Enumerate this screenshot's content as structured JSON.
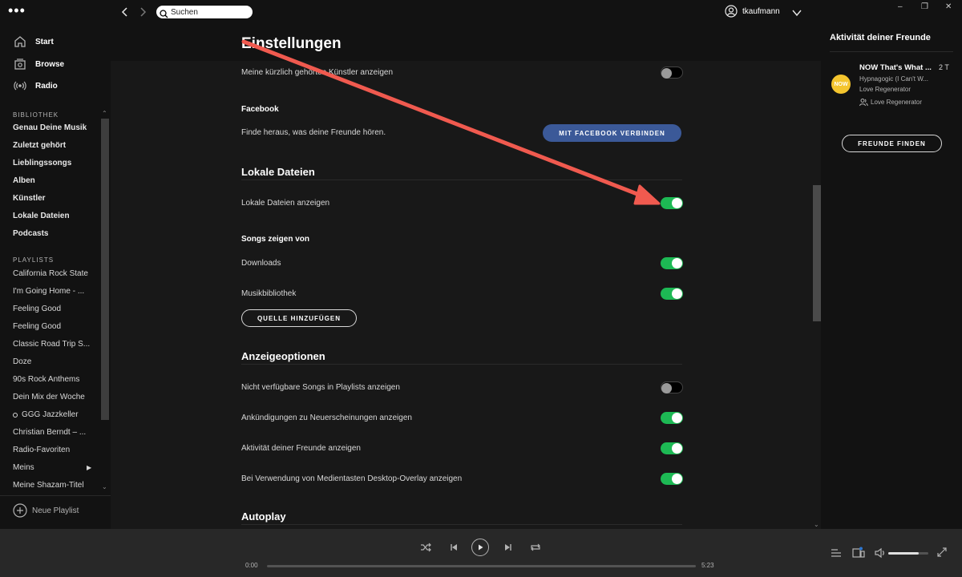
{
  "window": {
    "menu_dots": "•••"
  },
  "nav": {
    "items": [
      {
        "label": "Start",
        "icon": "home-icon"
      },
      {
        "label": "Browse",
        "icon": "browse-icon"
      },
      {
        "label": "Radio",
        "icon": "radio-icon"
      }
    ]
  },
  "library": {
    "heading": "BIBLIOTHEK",
    "items": [
      "Genau Deine Musik",
      "Zuletzt gehört",
      "Lieblingssongs",
      "Alben",
      "Künstler",
      "Lokale Dateien",
      "Podcasts"
    ]
  },
  "playlists": {
    "heading": "PLAYLISTS",
    "items": [
      "California Rock State",
      "I'm Going Home - ...",
      "Feeling Good",
      "Feeling Good",
      "Classic Road Trip S...",
      "Doze",
      "90s Rock Anthems",
      "Dein Mix der Woche",
      "GGG Jazzkeller",
      "Christian Berndt – ...",
      "Radio-Favoriten",
      "Meins",
      "Meine Shazam-Titel"
    ],
    "new_playlist": "Neue Playlist"
  },
  "topbar": {
    "search_placeholder": "Suchen",
    "username": "tkaufmann"
  },
  "settings": {
    "title": "Einstellungen",
    "recent_artists": {
      "label": "Meine kürzlich gehörten Künstler anzeigen",
      "on": false
    },
    "facebook": {
      "heading": "Facebook",
      "text": "Finde heraus, was deine Freunde hören.",
      "button": "MIT FACEBOOK VERBINDEN"
    },
    "local_files": {
      "heading": "Lokale Dateien",
      "show_label": "Lokale Dateien anzeigen",
      "show_on": true,
      "sources_heading": "Songs zeigen von",
      "sources": [
        {
          "label": "Downloads",
          "on": true
        },
        {
          "label": "Musikbibliothek",
          "on": true
        }
      ],
      "add_source": "QUELLE HINZUFÜGEN"
    },
    "display": {
      "heading": "Anzeigeoptionen",
      "options": [
        {
          "label": "Nicht verfügbare Songs in Playlists anzeigen",
          "on": false
        },
        {
          "label": "Ankündigungen zu Neuerscheinungen anzeigen",
          "on": true
        },
        {
          "label": "Aktivität deiner Freunde anzeigen",
          "on": true
        },
        {
          "label": "Bei Verwendung von Medientasten Desktop-Overlay anzeigen",
          "on": true
        }
      ]
    },
    "autoplay": {
      "heading": "Autoplay"
    }
  },
  "friends": {
    "title": "Aktivität deiner Freunde",
    "activity": {
      "avatar_text": "NOW",
      "song": "NOW That's What ...",
      "time": "2 T",
      "artist": "Hypnagogic (I Can't W...",
      "album": "Love Regenerator",
      "context": "Love Regenerator"
    },
    "find_button": "FREUNDE FINDEN"
  },
  "player": {
    "current_time": "0:00",
    "total_time": "5:23",
    "progress": 0.0,
    "volume": 0.75
  },
  "colors": {
    "accent_green": "#1db954",
    "facebook_blue": "#3b5998",
    "annotation_red": "#f05a4f"
  }
}
